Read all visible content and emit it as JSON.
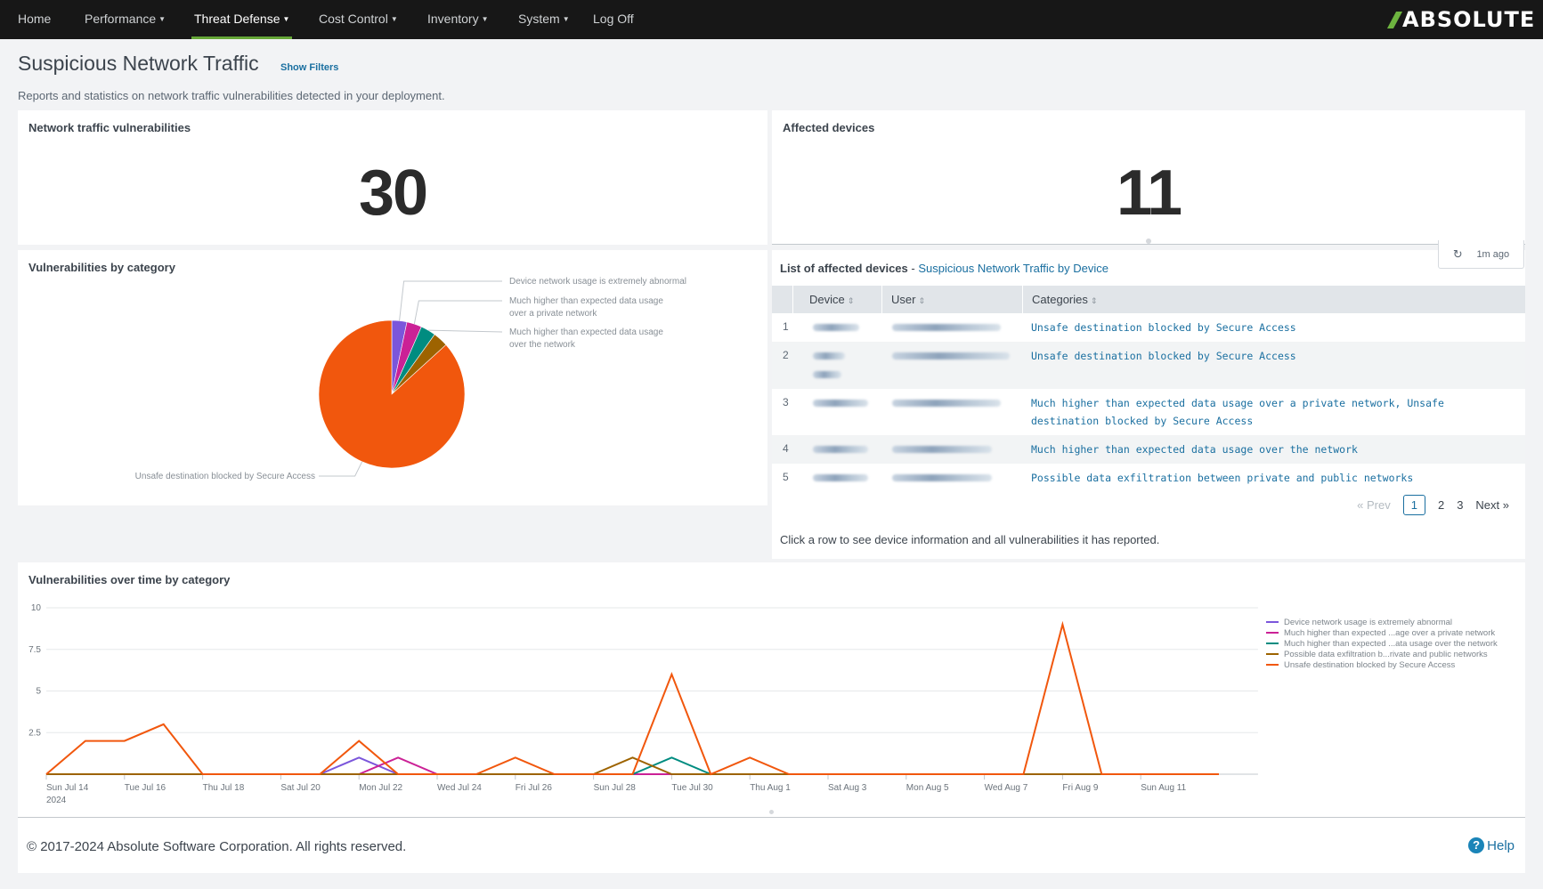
{
  "nav": {
    "items": [
      {
        "label": "Home",
        "dropdown": false
      },
      {
        "label": "Performance",
        "dropdown": true
      },
      {
        "label": "Threat Defense",
        "dropdown": true,
        "active": true
      },
      {
        "label": "Cost Control",
        "dropdown": true
      },
      {
        "label": "Inventory",
        "dropdown": true
      },
      {
        "label": "System",
        "dropdown": true
      },
      {
        "label": "Log Off",
        "dropdown": false
      }
    ],
    "caret": "▼",
    "logo_text": "ABSOLUTE",
    "accent_color": "#65a637"
  },
  "header": {
    "title": "Suspicious Network Traffic",
    "show_filters": "Show Filters",
    "description": "Reports and statistics on network traffic vulnerabilities detected in your deployment."
  },
  "kpis": {
    "vulnerabilities": {
      "title": "Network traffic vulnerabilities",
      "value": "30"
    },
    "affected_devices": {
      "title": "Affected devices",
      "value": "11"
    }
  },
  "pie": {
    "title": "Vulnerabilities by category"
  },
  "list": {
    "title": "List of affected devices",
    "separator": " - ",
    "link": "Suspicious Network Traffic by Device",
    "refresh_icon": "↻",
    "refresh_label": "1m ago",
    "columns": [
      "Device",
      "User",
      "Categories"
    ],
    "sort_icon": "⇕",
    "rows": [
      {
        "num": "1",
        "device": "[redacted]",
        "user": "[redacted]",
        "categories": "Unsafe destination blocked by Secure Access"
      },
      {
        "num": "2",
        "device": "[redacted]",
        "user": "[redacted]",
        "categories": "Unsafe destination blocked by Secure Access"
      },
      {
        "num": "3",
        "device": "[redacted]",
        "user": "[redacted]",
        "categories": "Much higher than expected data usage over a private network, Unsafe destination blocked by Secure Access"
      },
      {
        "num": "4",
        "device": "[redacted]",
        "user": "[redacted]",
        "categories": "Much higher than expected data usage over the network"
      },
      {
        "num": "5",
        "device": "[redacted]",
        "user": "[redacted]",
        "categories": "Possible data exfiltration between private and public networks"
      }
    ],
    "pagination": {
      "prev": "« Prev",
      "pages": [
        "1",
        "2",
        "3"
      ],
      "current": "1",
      "next": "Next »"
    },
    "footnote": "Click a row to see device information and all vulnerabilities it has reported."
  },
  "line": {
    "title": "Vulnerabilities over time by category"
  },
  "footer": {
    "copyright": "© 2017-2024 Absolute Software Corporation. All rights reserved.",
    "help_icon": "?",
    "help_label": "Help"
  },
  "chart_data": [
    {
      "type": "pie",
      "title": "Vulnerabilities by category",
      "slices": [
        {
          "label": "Device network usage is extremely abnormal",
          "value": 1,
          "color": "#7b56db",
          "shown_label": "Device network usage is extremely abnormal"
        },
        {
          "label": "Much higher than expected data usage over a private network",
          "value": 1,
          "color": "#cb2196",
          "shown_label": "Much higher than expected data usage over a private network"
        },
        {
          "label": "Much higher than expected data usage over the network",
          "value": 1,
          "color": "#008c80",
          "shown_label": "Much higher than expected data usage over the network"
        },
        {
          "label": "Possible data exfiltration between private and public networks",
          "value": 1,
          "color": "#9d6300",
          "shown_label": ""
        },
        {
          "label": "Unsafe destination blocked by Secure Access",
          "value": 26,
          "color": "#f1570d",
          "shown_label": "Unsafe destination blocked by Secure Access"
        }
      ]
    },
    {
      "type": "line",
      "title": "Vulnerabilities over time by category",
      "xlabel": "",
      "ylabel": "",
      "x_start": "2024-07-14",
      "x_days": 31,
      "x_ticks": [
        "Sun Jul 14",
        "Tue Jul 16",
        "Thu Jul 18",
        "Sat Jul 20",
        "Mon Jul 22",
        "Wed Jul 24",
        "Fri Jul 26",
        "Sun Jul 28",
        "Tue Jul 30",
        "Thu Aug 1",
        "Sat Aug 3",
        "Mon Aug 5",
        "Wed Aug 7",
        "Fri Aug 9",
        "Sun Aug 11"
      ],
      "x_tick_year": "2024",
      "y_ticks": [
        "2.5",
        "5",
        "7.5",
        "10"
      ],
      "ylim": [
        0,
        10
      ],
      "grid": true,
      "legend_position": "right",
      "series": [
        {
          "name": "Device network usage is extremely abnormal",
          "legend": "Device network usage is extremely abnormal",
          "color": "#7b56db",
          "values": [
            0,
            0,
            0,
            0,
            0,
            0,
            0,
            0,
            1,
            0,
            0,
            0,
            0,
            0,
            0,
            0,
            0,
            0,
            0,
            0,
            0,
            0,
            0,
            0,
            0,
            0,
            0,
            0,
            0,
            0,
            0
          ]
        },
        {
          "name": "Much higher than expected data usage over a private network",
          "legend": "Much higher than expected ...age over a private network",
          "color": "#cb2196",
          "values": [
            0,
            0,
            0,
            0,
            0,
            0,
            0,
            0,
            0,
            1,
            0,
            0,
            0,
            0,
            0,
            0,
            0,
            0,
            0,
            0,
            0,
            0,
            0,
            0,
            0,
            0,
            0,
            0,
            0,
            0,
            0
          ]
        },
        {
          "name": "Much higher than expected data usage over the network",
          "legend": "Much higher than expected ...ata usage over the network",
          "color": "#008c80",
          "values": [
            0,
            0,
            0,
            0,
            0,
            0,
            0,
            0,
            0,
            0,
            0,
            0,
            0,
            0,
            0,
            0,
            1,
            0,
            0,
            0,
            0,
            0,
            0,
            0,
            0,
            0,
            0,
            0,
            0,
            0,
            0
          ]
        },
        {
          "name": "Possible data exfiltration between private and public networks",
          "legend": "Possible data exfiltration b...rivate and public networks",
          "color": "#9d6300",
          "values": [
            0,
            0,
            0,
            0,
            0,
            0,
            0,
            0,
            0,
            0,
            0,
            0,
            0,
            0,
            0,
            1,
            0,
            0,
            0,
            0,
            0,
            0,
            0,
            0,
            0,
            0,
            0,
            0,
            0,
            0,
            0
          ]
        },
        {
          "name": "Unsafe destination blocked by Secure Access",
          "legend": "Unsafe destination blocked by Secure Access",
          "color": "#f1570d",
          "values": [
            0,
            2,
            2,
            3,
            0,
            0,
            0,
            0,
            2,
            0,
            0,
            0,
            1,
            0,
            0,
            0,
            6,
            0,
            1,
            0,
            0,
            0,
            0,
            0,
            0,
            0,
            9,
            0,
            0,
            0,
            0
          ]
        }
      ]
    }
  ]
}
